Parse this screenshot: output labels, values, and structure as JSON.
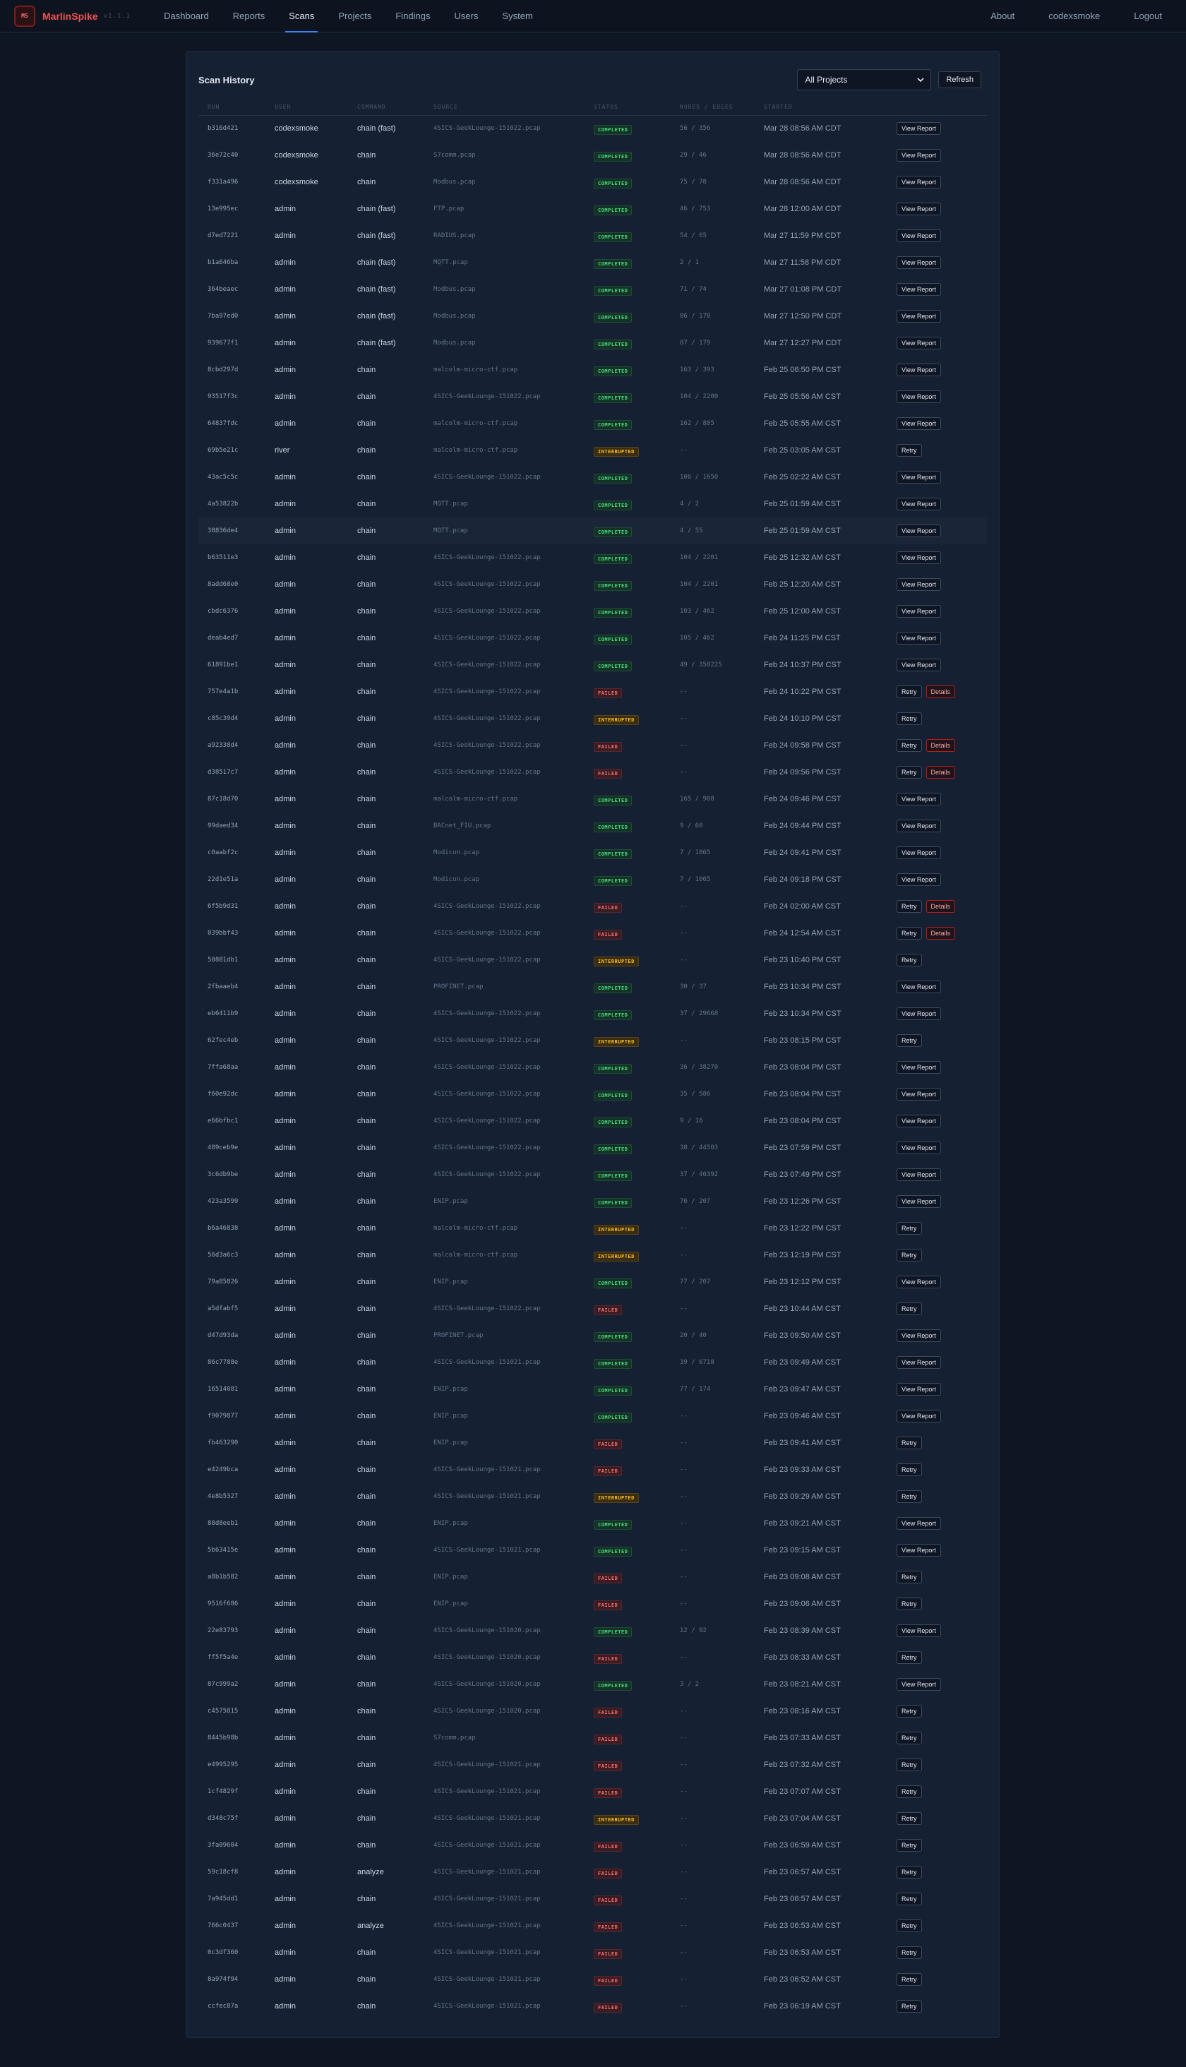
{
  "app": {
    "logo_text": "MS",
    "name": "MarlinSpike",
    "version": "v1.1.1"
  },
  "nav": {
    "links": [
      "Dashboard",
      "Reports",
      "Scans",
      "Projects",
      "Findings",
      "Users",
      "System"
    ],
    "active": "Scans",
    "right": [
      "About",
      "codexsmoke",
      "Logout"
    ]
  },
  "card": {
    "title": "Scan History",
    "project_filter": "All Projects",
    "refresh_label": "Refresh"
  },
  "columns": [
    "RUN",
    "USER",
    "COMMAND",
    "SOURCE",
    "STATUS",
    "NODES / EDGES",
    "STARTED",
    ""
  ],
  "labels": {
    "completed": "COMPLETED",
    "failed": "FAILED",
    "interrupted": "INTERRUPTED",
    "view_report": "View Report",
    "retry": "Retry",
    "details": "Details"
  },
  "rows": [
    [
      "b316d421",
      "codexsmoke",
      "chain (fast)",
      "4SICS-GeekLounge-151022.pcap",
      "completed",
      "56 / 356",
      "Mar 28 08:56 AM CDT"
    ],
    [
      "36e72c40",
      "codexsmoke",
      "chain",
      "S7comm.pcap",
      "completed",
      "29 / 46",
      "Mar 28 08:56 AM CDT"
    ],
    [
      "f331a496",
      "codexsmoke",
      "chain",
      "Modbus.pcap",
      "completed",
      "75 / 78",
      "Mar 28 08:56 AM CDT"
    ],
    [
      "13e995ec",
      "admin",
      "chain (fast)",
      "FTP.pcap",
      "completed",
      "46 / 753",
      "Mar 28 12:00 AM CDT"
    ],
    [
      "d7ed7221",
      "admin",
      "chain (fast)",
      "RADIUS.pcap",
      "completed",
      "54 / 65",
      "Mar 27 11:59 PM CDT"
    ],
    [
      "b1a646ba",
      "admin",
      "chain (fast)",
      "MQTT.pcap",
      "completed",
      "2 / 1",
      "Mar 27 11:58 PM CDT"
    ],
    [
      "364beaec",
      "admin",
      "chain (fast)",
      "Modbus.pcap",
      "completed",
      "71 / 74",
      "Mar 27 01:08 PM CDT"
    ],
    [
      "7ba97ed0",
      "admin",
      "chain (fast)",
      "Modbus.pcap",
      "completed",
      "86 / 178",
      "Mar 27 12:50 PM CDT"
    ],
    [
      "939677f1",
      "admin",
      "chain (fast)",
      "Modbus.pcap",
      "completed",
      "87 / 179",
      "Mar 27 12:27 PM CDT"
    ],
    [
      "8cbd297d",
      "admin",
      "chain",
      "malcolm-micro-ctf.pcap",
      "completed",
      "163 / 393",
      "Feb 25 06:50 PM CST"
    ],
    [
      "93517f3c",
      "admin",
      "chain",
      "4SICS-GeekLounge-151022.pcap",
      "completed",
      "104 / 2200",
      "Feb 25 05:56 AM CST"
    ],
    [
      "64837fdc",
      "admin",
      "chain",
      "malcolm-micro-ctf.pcap",
      "completed",
      "162 / 885",
      "Feb 25 05:55 AM CST"
    ],
    [
      "69b5e21c",
      "river",
      "chain",
      "malcolm-micro-ctf.pcap",
      "interrupted",
      "--",
      "Feb 25 03:05 AM CST"
    ],
    [
      "43ac5c5c",
      "admin",
      "chain",
      "4SICS-GeekLounge-151022.pcap",
      "completed",
      "106 / 1650",
      "Feb 25 02:22 AM CST"
    ],
    [
      "4a53822b",
      "admin",
      "chain",
      "MQTT.pcap",
      "completed",
      "4 / 2",
      "Feb 25 01:59 AM CST"
    ],
    [
      "38836de4",
      "admin",
      "chain",
      "MQTT.pcap",
      "completed",
      "4 / 55",
      "Feb 25 01:59 AM CST"
    ],
    [
      "b63511e3",
      "admin",
      "chain",
      "4SICS-GeekLounge-151022.pcap",
      "completed",
      "104 / 2201",
      "Feb 25 12:32 AM CST"
    ],
    [
      "8add68e0",
      "admin",
      "chain",
      "4SICS-GeekLounge-151022.pcap",
      "completed",
      "104 / 2201",
      "Feb 25 12:20 AM CST"
    ],
    [
      "cbdc6376",
      "admin",
      "chain",
      "4SICS-GeekLounge-151022.pcap",
      "completed",
      "103 / 462",
      "Feb 25 12:00 AM CST"
    ],
    [
      "deab4ed7",
      "admin",
      "chain",
      "4SICS-GeekLounge-151022.pcap",
      "completed",
      "105 / 462",
      "Feb 24 11:25 PM CST"
    ],
    [
      "61891be1",
      "admin",
      "chain",
      "4SICS-GeekLounge-151022.pcap",
      "completed",
      "49 / 358225",
      "Feb 24 10:37 PM CST"
    ],
    [
      "757e4a1b",
      "admin",
      "chain",
      "4SICS-GeekLounge-151022.pcap",
      "failed",
      "--",
      "Feb 24 10:22 PM CST"
    ],
    [
      "c85c39d4",
      "admin",
      "chain",
      "4SICS-GeekLounge-151022.pcap",
      "interrupted",
      "--",
      "Feb 24 10:10 PM CST"
    ],
    [
      "a92338d4",
      "admin",
      "chain",
      "4SICS-GeekLounge-151022.pcap",
      "failed",
      "--",
      "Feb 24 09:58 PM CST"
    ],
    [
      "d38517c7",
      "admin",
      "chain",
      "4SICS-GeekLounge-151022.pcap",
      "failed",
      "--",
      "Feb 24 09:56 PM CST"
    ],
    [
      "87c18d70",
      "admin",
      "chain",
      "malcolm-micro-ctf.pcap",
      "completed",
      "165 / 908",
      "Feb 24 09:46 PM CST"
    ],
    [
      "99daed34",
      "admin",
      "chain",
      "BACnet_FIU.pcap",
      "completed",
      "9 / 60",
      "Feb 24 09:44 PM CST"
    ],
    [
      "c0aabf2c",
      "admin",
      "chain",
      "Modicon.pcap",
      "completed",
      "7 / 1065",
      "Feb 24 09:41 PM CST"
    ],
    [
      "22d1e51a",
      "admin",
      "chain",
      "Modicon.pcap",
      "completed",
      "7 / 1065",
      "Feb 24 09:18 PM CST"
    ],
    [
      "6f5b9d31",
      "admin",
      "chain",
      "4SICS-GeekLounge-151022.pcap",
      "failed",
      "--",
      "Feb 24 02:00 AM CST"
    ],
    [
      "039bbf43",
      "admin",
      "chain",
      "4SICS-GeekLounge-151022.pcap",
      "failed",
      "--",
      "Feb 24 12:54 AM CST"
    ],
    [
      "50881db1",
      "admin",
      "chain",
      "4SICS-GeekLounge-151022.pcap",
      "interrupted",
      "--",
      "Feb 23 10:40 PM CST"
    ],
    [
      "2fbaaeb4",
      "admin",
      "chain",
      "PROFINET.pcap",
      "completed",
      "30 / 37",
      "Feb 23 10:34 PM CST"
    ],
    [
      "eb6411b9",
      "admin",
      "chain",
      "4SICS-GeekLounge-151022.pcap",
      "completed",
      "37 / 29668",
      "Feb 23 10:34 PM CST"
    ],
    [
      "62fec4eb",
      "admin",
      "chain",
      "4SICS-GeekLounge-151022.pcap",
      "interrupted",
      "--",
      "Feb 23 08:15 PM CST"
    ],
    [
      "7ffa68aa",
      "admin",
      "chain",
      "4SICS-GeekLounge-151022.pcap",
      "completed",
      "36 / 38270",
      "Feb 23 08:04 PM CST"
    ],
    [
      "f60e92dc",
      "admin",
      "chain",
      "4SICS-GeekLounge-151022.pcap",
      "completed",
      "35 / 586",
      "Feb 23 08:04 PM CST"
    ],
    [
      "e66bfbc1",
      "admin",
      "chain",
      "4SICS-GeekLounge-151022.pcap",
      "completed",
      "9 / 16",
      "Feb 23 08:04 PM CST"
    ],
    [
      "489ceb9e",
      "admin",
      "chain",
      "4SICS-GeekLounge-151022.pcap",
      "completed",
      "38 / 44503",
      "Feb 23 07:59 PM CST"
    ],
    [
      "3c6db9be",
      "admin",
      "chain",
      "4SICS-GeekLounge-151022.pcap",
      "completed",
      "37 / 40392",
      "Feb 23 07:49 PM CST"
    ],
    [
      "423a3599",
      "admin",
      "chain",
      "ENIP.pcap",
      "completed",
      "76 / 207",
      "Feb 23 12:26 PM CST"
    ],
    [
      "b6a46838",
      "admin",
      "chain",
      "malcolm-micro-ctf.pcap",
      "interrupted",
      "--",
      "Feb 23 12:22 PM CST"
    ],
    [
      "56d3a6c3",
      "admin",
      "chain",
      "malcolm-micro-ctf.pcap",
      "interrupted",
      "--",
      "Feb 23 12:19 PM CST"
    ],
    [
      "79a85826",
      "admin",
      "chain",
      "ENIP.pcap",
      "completed",
      "77 / 207",
      "Feb 23 12:12 PM CST"
    ],
    [
      "a5dfabf5",
      "admin",
      "chain",
      "4SICS-GeekLounge-151022.pcap",
      "failed",
      "--",
      "Feb 23 10:44 AM CST"
    ],
    [
      "d47d93da",
      "admin",
      "chain",
      "PROFINET.pcap",
      "completed",
      "20 / 40",
      "Feb 23 09:50 AM CST"
    ],
    [
      "86c7788e",
      "admin",
      "chain",
      "4SICS-GeekLounge-151021.pcap",
      "completed",
      "39 / 6718",
      "Feb 23 09:49 AM CST"
    ],
    [
      "16514081",
      "admin",
      "chain",
      "ENIP.pcap",
      "completed",
      "77 / 174",
      "Feb 23 09:47 AM CST"
    ],
    [
      "f9079877",
      "admin",
      "chain",
      "ENIP.pcap",
      "completed",
      "--",
      "Feb 23 09:46 AM CST"
    ],
    [
      "fb463290",
      "admin",
      "chain",
      "ENIP.pcap",
      "failed",
      "--",
      "Feb 23 09:41 AM CST"
    ],
    [
      "e4249bca",
      "admin",
      "chain",
      "4SICS-GeekLounge-151021.pcap",
      "failed",
      "--",
      "Feb 23 09:33 AM CST"
    ],
    [
      "4e8b5327",
      "admin",
      "chain",
      "4SICS-GeekLounge-151021.pcap",
      "interrupted",
      "--",
      "Feb 23 09:29 AM CST"
    ],
    [
      "88d8eeb1",
      "admin",
      "chain",
      "ENIP.pcap",
      "completed",
      "--",
      "Feb 23 09:21 AM CST"
    ],
    [
      "5b63415e",
      "admin",
      "chain",
      "4SICS-GeekLounge-151021.pcap",
      "completed",
      "--",
      "Feb 23 09:15 AM CST"
    ],
    [
      "a8b1b582",
      "admin",
      "chain",
      "ENIP.pcap",
      "failed",
      "--",
      "Feb 23 09:08 AM CST"
    ],
    [
      "9516f686",
      "admin",
      "chain",
      "ENIP.pcap",
      "failed",
      "--",
      "Feb 23 09:06 AM CST"
    ],
    [
      "22e83793",
      "admin",
      "chain",
      "4SICS-GeekLounge-151020.pcap",
      "completed",
      "12 / 92",
      "Feb 23 08:39 AM CST"
    ],
    [
      "ff5f5a4e",
      "admin",
      "chain",
      "4SICS-GeekLounge-151020.pcap",
      "failed",
      "--",
      "Feb 23 08:33 AM CST"
    ],
    [
      "87c999a2",
      "admin",
      "chain",
      "4SICS-GeekLounge-151020.pcap",
      "completed",
      "3 / 2",
      "Feb 23 08:21 AM CST"
    ],
    [
      "c4575815",
      "admin",
      "chain",
      "4SICS-GeekLounge-151020.pcap",
      "failed",
      "--",
      "Feb 23 08:16 AM CST"
    ],
    [
      "8445b98b",
      "admin",
      "chain",
      "S7comm.pcap",
      "failed",
      "--",
      "Feb 23 07:33 AM CST"
    ],
    [
      "e4995295",
      "admin",
      "chain",
      "4SICS-GeekLounge-151021.pcap",
      "failed",
      "--",
      "Feb 23 07:32 AM CST"
    ],
    [
      "1cf4829f",
      "admin",
      "chain",
      "4SICS-GeekLounge-151021.pcap",
      "failed",
      "--",
      "Feb 23 07:07 AM CST"
    ],
    [
      "d348c75f",
      "admin",
      "chain",
      "4SICS-GeekLounge-151021.pcap",
      "interrupted",
      "--",
      "Feb 23 07:04 AM CST"
    ],
    [
      "3fa09604",
      "admin",
      "chain",
      "4SICS-GeekLounge-151021.pcap",
      "failed",
      "--",
      "Feb 23 06:59 AM CST"
    ],
    [
      "59c18cf8",
      "admin",
      "analyze",
      "4SICS-GeekLounge-151021.pcap",
      "failed",
      "--",
      "Feb 23 06:57 AM CST"
    ],
    [
      "7a945dd1",
      "admin",
      "chain",
      "4SICS-GeekLounge-151021.pcap",
      "failed",
      "--",
      "Feb 23 06:57 AM CST"
    ],
    [
      "766c0437",
      "admin",
      "analyze",
      "4SICS-GeekLounge-151021.pcap",
      "failed",
      "--",
      "Feb 23 06:53 AM CST"
    ],
    [
      "0c3df360",
      "admin",
      "chain",
      "4SICS-GeekLounge-151021.pcap",
      "failed",
      "--",
      "Feb 23 06:53 AM CST"
    ],
    [
      "8a974f94",
      "admin",
      "chain",
      "4SICS-GeekLounge-151021.pcap",
      "failed",
      "--",
      "Feb 23 06:52 AM CST"
    ],
    [
      "ccfec87a",
      "admin",
      "chain",
      "4SICS-GeekLounge-151021.pcap",
      "failed",
      "--",
      "Feb 23 06:19 AM CST"
    ]
  ],
  "details_rows": [
    "757e4a1b",
    "a92338d4",
    "d38517c7",
    "6f5b9d31",
    "039bbf43"
  ],
  "highlighted_row": "38836de4"
}
